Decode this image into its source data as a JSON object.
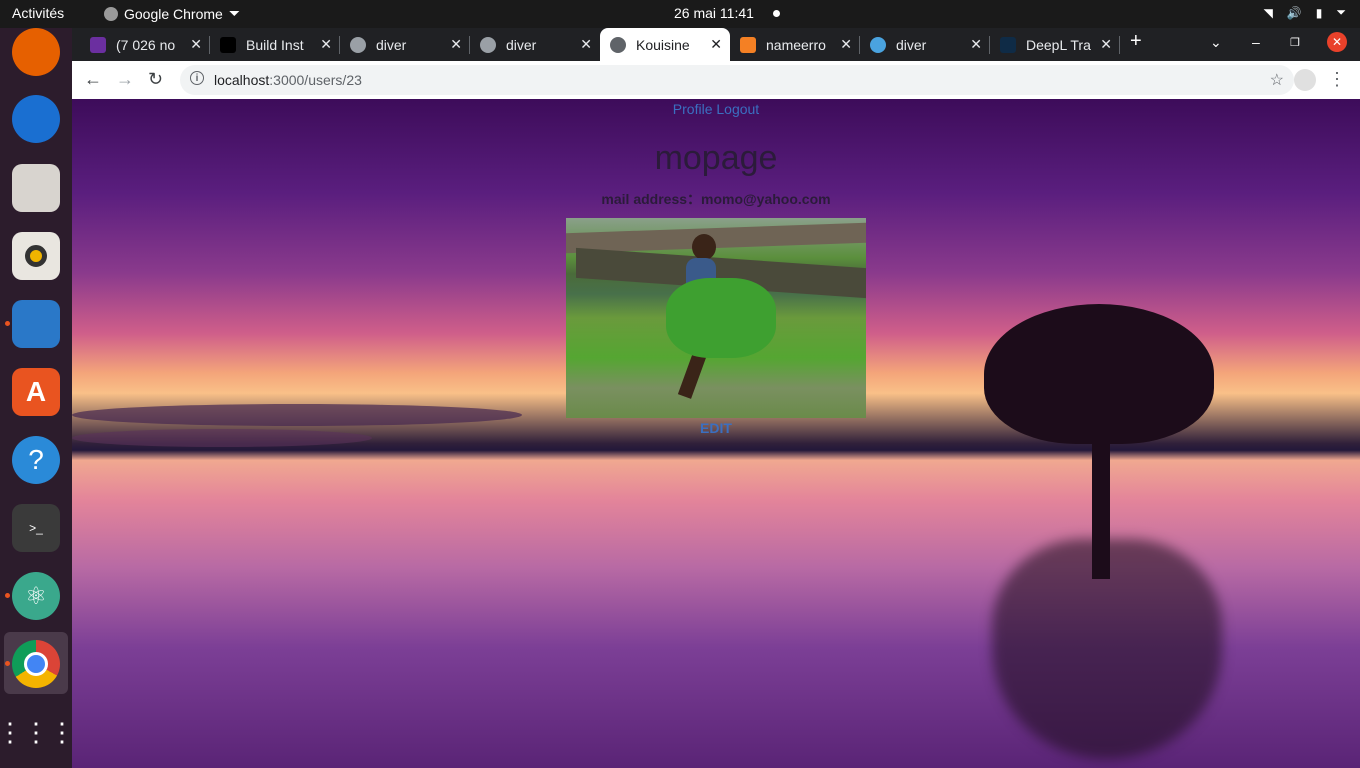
{
  "topbar": {
    "activities": "Activités",
    "app_name": "Google Chrome",
    "clock": "26 mai  11:41"
  },
  "dock": {
    "items": [
      "firefox-icon",
      "thunderbird-icon",
      "files-icon",
      "rhythmbox-icon",
      "writer-icon",
      "software-icon",
      "help-icon",
      "terminal-icon",
      "atom-icon",
      "chrome-icon",
      "apps-grid-icon"
    ]
  },
  "tabs": [
    {
      "title": "(7 026 no",
      "color": "#6b2fa0"
    },
    {
      "title": "Build Inst",
      "color": "#000000"
    },
    {
      "title": "diver",
      "color": "#9aa0a6"
    },
    {
      "title": "diver",
      "color": "#9aa0a6"
    },
    {
      "title": "Kouisine",
      "color": "#5f6368"
    },
    {
      "title": "nameerro",
      "color": "#f48024"
    },
    {
      "title": "diver",
      "color": "#4aa3df"
    },
    {
      "title": "DeepL Tra",
      "color": "#0f2b46"
    }
  ],
  "address_bar": {
    "host": "localhost",
    "path": ":3000/users/23"
  },
  "page": {
    "nav_profile": "Profile",
    "nav_logout": "Logout",
    "username": "mopage",
    "email": "mail address：momo@yahoo.com",
    "edit": "EDIT"
  },
  "colors": {
    "link": "#3b6fc0",
    "chrome_dark": "#202124",
    "ubuntu_orange": "#e95420"
  }
}
